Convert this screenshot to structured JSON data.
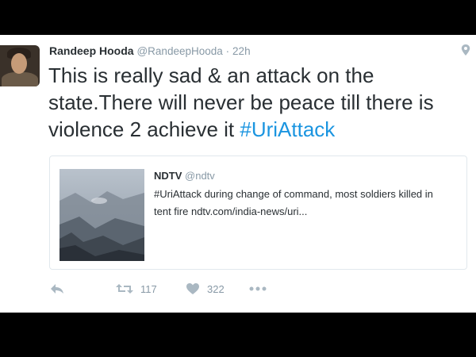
{
  "tweet": {
    "author_name": "Randeep Hooda",
    "author_handle": "@RandeepHooda",
    "separator": "·",
    "time": "22h",
    "text_main": "This is really sad & an attack on the state.There will never be peace till there is violence 2 achieve it ",
    "text_hashtag": "#UriAttack",
    "hashtag_color": "#1b95e0"
  },
  "quote": {
    "author_name": "NDTV",
    "author_handle": "@ndtv",
    "text": "#UriAttack during change of command, most soldiers killed in tent fire ndtv.com/india-news/uri..."
  },
  "actions": {
    "reply_icon": "reply-icon",
    "retweet_icon": "retweet-icon",
    "retweet_count": "117",
    "like_icon": "heart-icon",
    "like_count": "322",
    "more_icon": "more-icon"
  },
  "icons": {
    "location": "location-pin-icon"
  },
  "colors": {
    "text": "#292f33",
    "muted": "#8899a6",
    "border": "#e1e8ed",
    "letterbox": "#000000"
  }
}
